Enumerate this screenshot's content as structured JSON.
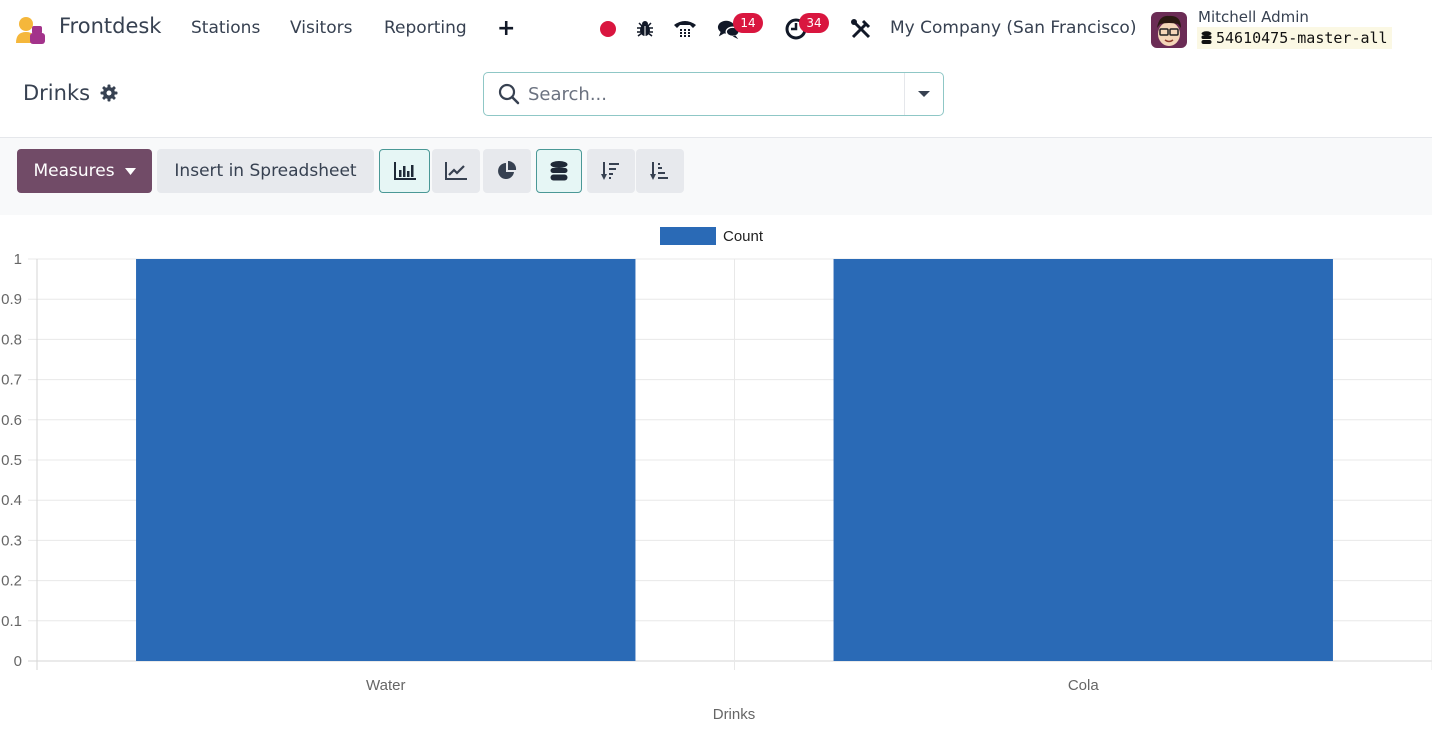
{
  "navbar": {
    "app_name": "Frontdesk",
    "menu": [
      "Stations",
      "Visitors",
      "Reporting"
    ],
    "plus_label": "+",
    "messages_count": "14",
    "activities_count": "34",
    "company": "My Company (San Francisco)",
    "user_name": "Mitchell Admin",
    "database": "54610475-master-all",
    "icons": [
      "recording-dot-icon",
      "bug-icon",
      "phone-icon",
      "chat-icon",
      "clock-icon",
      "tools-icon"
    ]
  },
  "control_panel": {
    "title": "Drinks",
    "search_placeholder": "Search..."
  },
  "toolbar": {
    "measures_label": "Measures",
    "insert_label": "Insert in Spreadsheet",
    "view_buttons": [
      "bar-chart",
      "line-chart",
      "pie-chart",
      "stacked",
      "sort-descending",
      "sort-ascending"
    ],
    "active": [
      "bar-chart",
      "stacked"
    ]
  },
  "colors": {
    "primary": "#714b67",
    "bar": "#2a6ab6",
    "badge": "#d9163f"
  },
  "chart_data": {
    "type": "bar",
    "categories": [
      "Water",
      "Cola"
    ],
    "series": [
      {
        "name": "Count",
        "values": [
          1,
          1
        ]
      }
    ],
    "title": "",
    "xlabel": "Drinks",
    "ylabel": "",
    "ylim": [
      0,
      1
    ],
    "yticks": [
      "0",
      "0.1",
      "0.2",
      "0.3",
      "0.4",
      "0.5",
      "0.6",
      "0.7",
      "0.8",
      "0.9",
      "1"
    ],
    "grid": true,
    "legend": "top-center"
  }
}
